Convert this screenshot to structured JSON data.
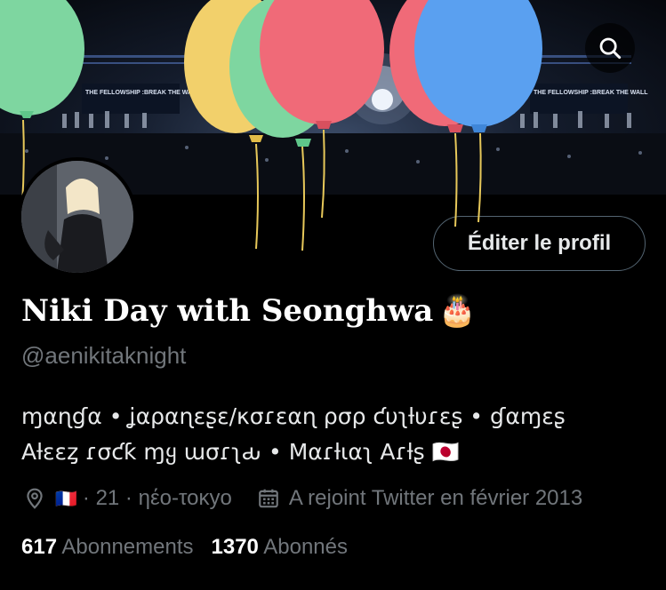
{
  "header": {
    "back_icon": "arrow-left-icon",
    "search_icon": "search-icon"
  },
  "banner": {
    "stage_text_left": "THE FELLOWSHIP :BREAK THE WALL",
    "stage_text_right": "THE FELLOWSHIP :BREAK THE WALL",
    "balloon_colors": [
      "#7ed6a0",
      "#f2d06b",
      "#f06a78",
      "#5aa0f0"
    ]
  },
  "profile": {
    "display_name": "Niki Day with Seonghwa",
    "name_emoji": "🎂",
    "handle": "@aenikitaknight",
    "edit_button_label": "Éditer le profil",
    "bio_line_1": "ɱαɳɠα • ʝαραɳεʂε/κσɾεαɳ ρσρ ƈυʅƚυɾεʂ • ɠαɱεʂ",
    "bio_line_2": "Aƚεεȥ ɾσƈƙ ɱყ ɯσɾʅԃ • Mαɾƚιαʅ Aɾƚʂ 🇯🇵",
    "location_flag": "🇫🇷",
    "location_text": "· 21 · ηέο-τοκуο",
    "joined_text": "A rejoint Twitter en février 2013",
    "following_count": "617",
    "following_label": "Abonnements",
    "followers_count": "1370",
    "followers_label": "Abonnés"
  },
  "colors": {
    "background": "#000000",
    "text_primary": "#e7e9ea",
    "text_secondary": "#71767b",
    "button_border": "#536471"
  }
}
